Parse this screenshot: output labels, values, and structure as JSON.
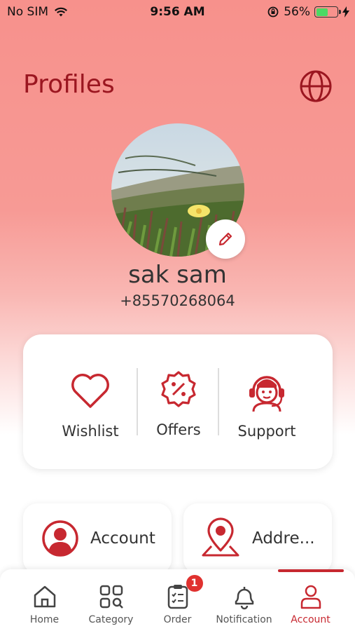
{
  "status_bar": {
    "carrier": "No SIM",
    "time": "9:56 AM",
    "battery_percent": "56%",
    "battery_level": 0.56
  },
  "header": {
    "title": "Profiles",
    "language_icon": "globe-icon"
  },
  "profile": {
    "name": "sak sam",
    "phone": "+85570268064",
    "edit_icon": "pencil-icon"
  },
  "quick_actions": [
    {
      "label": "Wishlist",
      "icon": "heart-icon"
    },
    {
      "label": "Offers",
      "icon": "discount-badge-icon"
    },
    {
      "label": "Support",
      "icon": "support-agent-icon"
    }
  ],
  "tiles": [
    {
      "label": "Account",
      "icon": "user-circle-icon"
    },
    {
      "label": "Addre...",
      "icon": "location-pin-icon"
    }
  ],
  "tabbar": {
    "items": [
      {
        "label": "Home",
        "icon": "home-icon"
      },
      {
        "label": "Category",
        "icon": "category-grid-icon"
      },
      {
        "label": "Order",
        "icon": "clipboard-icon",
        "badge": "1"
      },
      {
        "label": "Notification",
        "icon": "bell-icon"
      },
      {
        "label": "Account",
        "icon": "user-icon",
        "active": true
      }
    ]
  },
  "colors": {
    "brand": "#c72830",
    "title": "#9b1620",
    "header_bg": "#f7918c"
  }
}
